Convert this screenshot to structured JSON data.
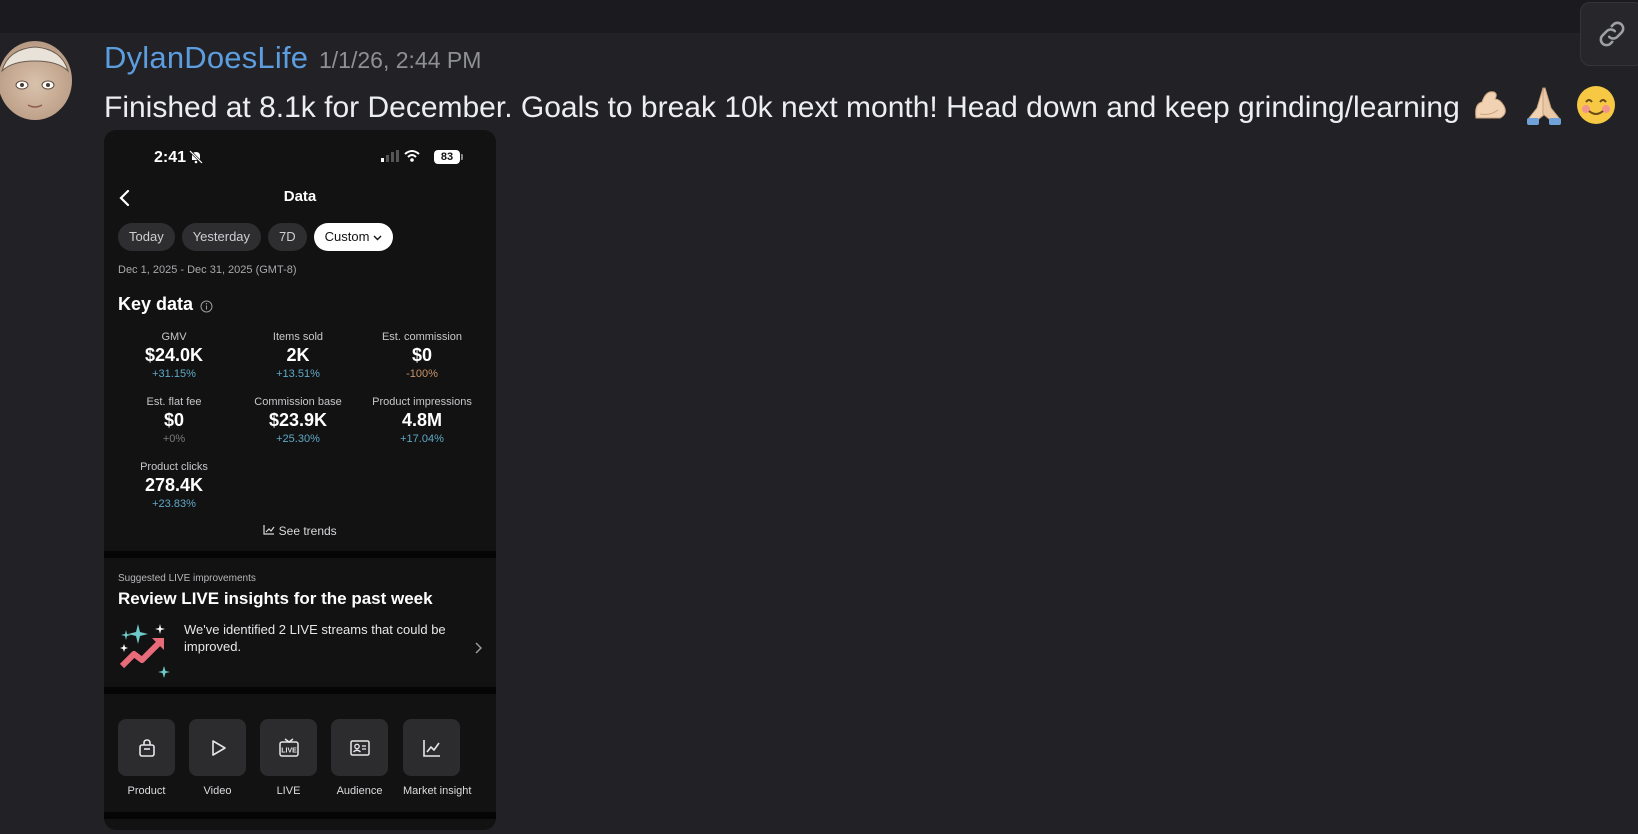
{
  "message": {
    "author": "DylanDoesLife",
    "timestamp": "1/1/26, 2:44 PM",
    "text": "Finished at 8.1k for December. Goals to break 10k next month! Head down and keep grinding/learning",
    "emojis": [
      "flexed-biceps",
      "folded-hands",
      "smiling-face-with-smiling-eyes"
    ]
  },
  "phone": {
    "status_time": "2:41",
    "battery": "83",
    "screen_title": "Data",
    "chips": [
      "Today",
      "Yesterday",
      "7D",
      "Custom"
    ],
    "active_chip": "Custom",
    "date_range": "Dec 1, 2025 - Dec 31, 2025 (GMT-8)",
    "key_data_title": "Key data",
    "metrics": [
      {
        "label": "GMV",
        "value": "$24.0K",
        "change": "+31.15%",
        "trend": "up"
      },
      {
        "label": "Items sold",
        "value": "2K",
        "change": "+13.51%",
        "trend": "up"
      },
      {
        "label": "Est. commission",
        "value": "$0",
        "change": "-100%",
        "trend": "down"
      },
      {
        "label": "Est. flat fee",
        "value": "$0",
        "change": "+0%",
        "trend": "flat"
      },
      {
        "label": "Commission base",
        "value": "$23.9K",
        "change": "+25.30%",
        "trend": "up"
      },
      {
        "label": "Product impressions",
        "value": "4.8M",
        "change": "+17.04%",
        "trend": "up"
      },
      {
        "label": "Product clicks",
        "value": "278.4K",
        "change": "+23.83%",
        "trend": "up"
      }
    ],
    "see_trends": "See trends",
    "suggestion": {
      "label": "Suggested LIVE improvements",
      "title": "Review LIVE insights for the past week",
      "text": "We've identified 2 LIVE streams that could be improved."
    },
    "tools": [
      {
        "label": "Product",
        "icon": "shopping-bag-icon"
      },
      {
        "label": "Video",
        "icon": "play-icon"
      },
      {
        "label": "LIVE",
        "icon": "live-tv-icon"
      },
      {
        "label": "Audience",
        "icon": "id-card-icon"
      },
      {
        "label": "Market insight",
        "icon": "line-chart-icon"
      }
    ]
  }
}
